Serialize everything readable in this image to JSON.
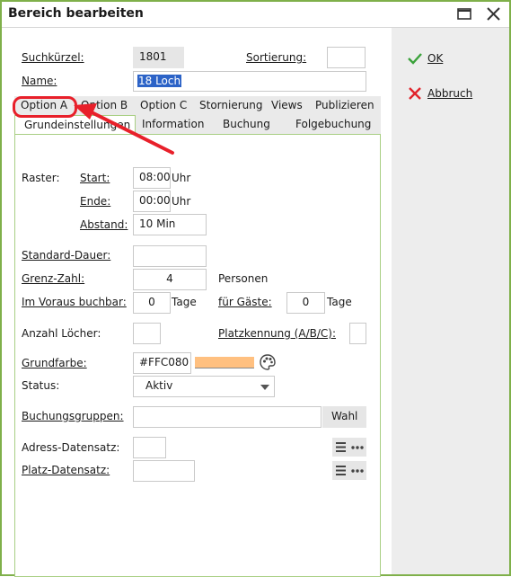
{
  "window": {
    "title": "Bereich bearbeiten"
  },
  "icons": {
    "maximize": "maximize-icon",
    "close": "close-icon",
    "ok": "checkmark-icon",
    "cancel": "x-icon",
    "palette": "palette-icon",
    "menu": "list-icon",
    "more": "ellipsis-icon"
  },
  "colors": {
    "accent": "#7fb04a",
    "ok_green": "#3aa23a",
    "cancel_red": "#e1232b",
    "annotation_red": "#e8202a",
    "swatch": "#FFC080"
  },
  "side": {
    "ok": "OK",
    "cancel": "Abbruch"
  },
  "header": {
    "suchkuerzel_label": "Suchkürzel:",
    "suchkuerzel_value": "1801",
    "sortierung_label": "Sortierung:",
    "sortierung_value": "",
    "name_label": "Name:",
    "name_value": "18 Loch"
  },
  "tabs_row1": [
    "Option A",
    "Option B",
    "Option C",
    "Stornierung",
    "Views",
    "Publizieren"
  ],
  "tabs_row2": [
    "Grundeinstellungen",
    "Information",
    "Buchung",
    "Folgebuchung"
  ],
  "active_tab": "Grundeinstellungen",
  "form": {
    "raster_label": "Raster:",
    "start_label": "Start:",
    "start_value": "08:00",
    "start_unit": "Uhr",
    "ende_label": "Ende:",
    "ende_value": "00:00",
    "ende_unit": "Uhr",
    "abstand_label": "Abstand:",
    "abstand_value": "10 Min",
    "standard_dauer_label": "Standard-Dauer:",
    "standard_dauer_value": "",
    "grenz_zahl_label": "Grenz-Zahl:",
    "grenz_zahl_value": "4",
    "grenz_zahl_unit": "Personen",
    "voraus_label": "Im Voraus buchbar:",
    "voraus_value": "0",
    "voraus_unit": "Tage",
    "gaeste_label": "für Gäste:",
    "gaeste_value": "0",
    "gaeste_unit": "Tage",
    "anzahl_loecher_label": "Anzahl Löcher:",
    "anzahl_loecher_value": "",
    "platzkennung_label": "Platzkennung (A/B/C):",
    "platzkennung_value": "",
    "grundfarbe_label": "Grundfarbe:",
    "grundfarbe_value": "#FFC080",
    "status_label": "Status:",
    "status_value": "Aktiv",
    "buchungsgruppen_label": "Buchungsgruppen:",
    "buchungsgruppen_value": "",
    "wahl_label": "Wahl",
    "adress_label": "Adress-Datensatz:",
    "adress_value": "",
    "platz_label": "Platz-Datensatz:",
    "platz_value": ""
  }
}
